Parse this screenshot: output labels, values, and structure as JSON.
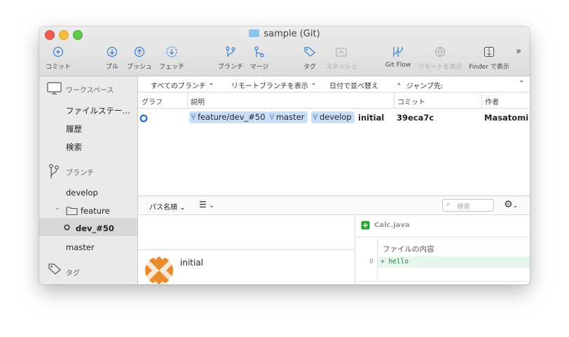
{
  "window": {
    "title": "sample (Git)"
  },
  "toolbar": {
    "commit": "コミット",
    "pull": "プル",
    "push": "プッシュ",
    "fetch": "フェッチ",
    "branch": "ブランチ",
    "merge": "マージ",
    "tag": "タグ",
    "stash": "スタッシュ",
    "gitflow": "Git Flow",
    "remote": "リモートを表示",
    "finder": "Finder で表示",
    "more": "»"
  },
  "sidebar": {
    "workspace_header": "ワークスペース",
    "workspace_items": [
      "ファイルステー…",
      "履歴",
      "検索"
    ],
    "branches_header": "ブランチ",
    "branches": {
      "develop": "develop",
      "feature_folder": "feature",
      "selected": "dev_#50",
      "master": "master"
    },
    "tags_header": "タグ"
  },
  "filters": {
    "all_branches": "すべてのブランチ",
    "show_remote": "リモートブランチを表示",
    "sort_by_date": "日付で並べ替え",
    "jump_to": "ジャンプ先:"
  },
  "columns": {
    "graph": "グラフ",
    "description": "説明",
    "commit": "コミット",
    "author": "作者"
  },
  "commits": [
    {
      "branches": [
        "feature/dev_#50",
        "master",
        "develop"
      ],
      "message": "initial",
      "hash": "39eca7c",
      "author": "Masatomi K"
    }
  ],
  "lower": {
    "sort_label": "パス名順",
    "search_placeholder": "検索",
    "commit_message": "initial",
    "file": {
      "name": "Calc.java",
      "section": "ファイルの内容",
      "line_no": "0",
      "line": "+ hello"
    }
  },
  "colors": {
    "accent": "#2f73c5",
    "tag_bg": "#c9dff5",
    "added": "#27a035",
    "diff_bg": "#e6f6ec",
    "avatar": "#e98a2c"
  }
}
